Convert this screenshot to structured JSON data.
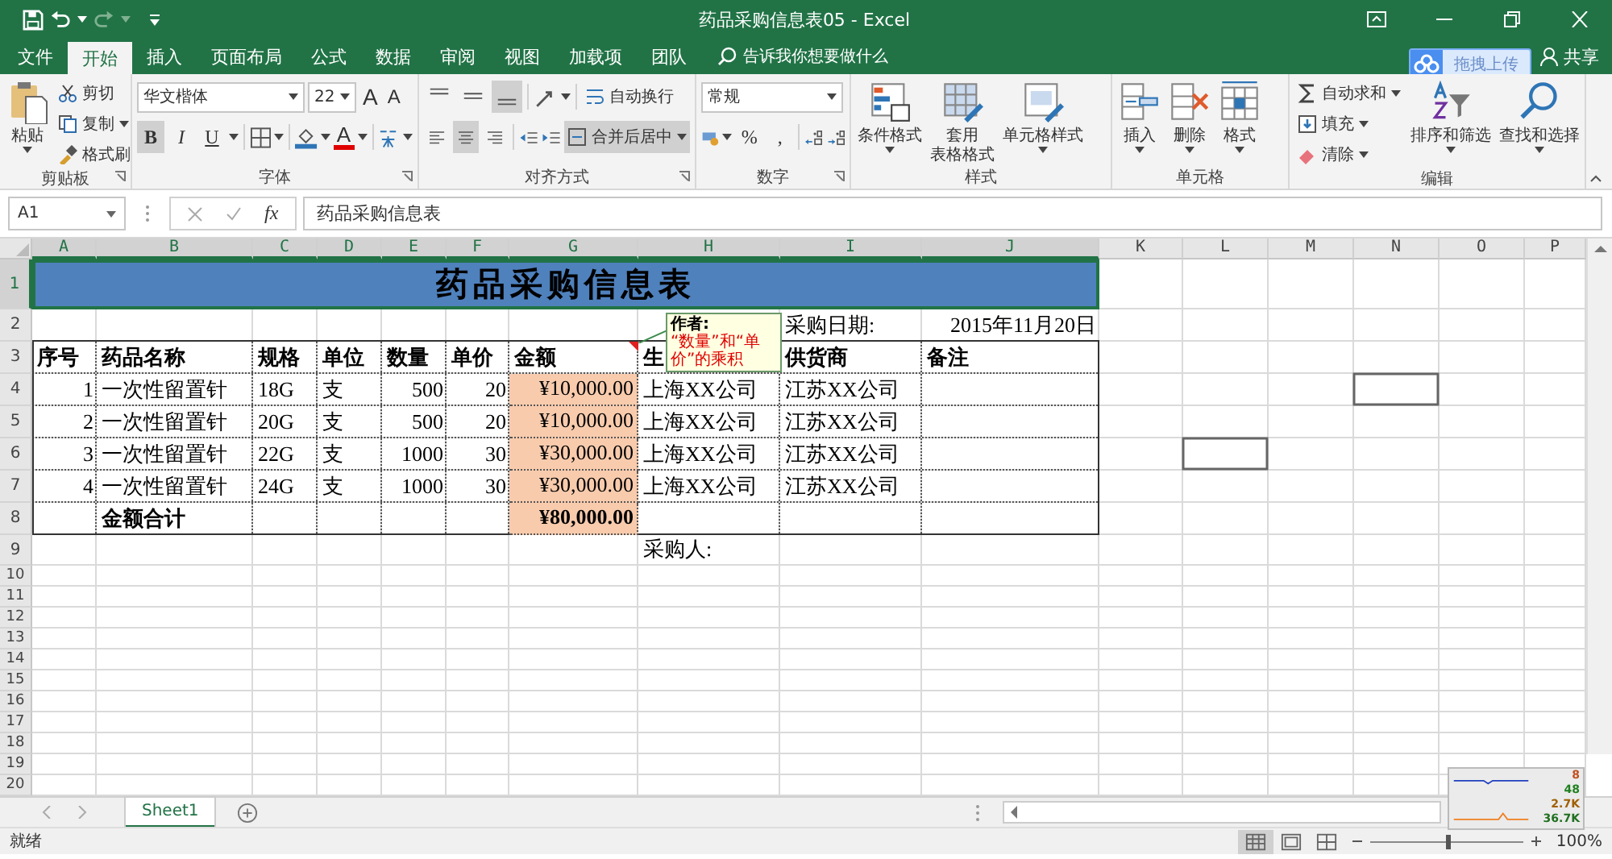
{
  "window": {
    "title": "药品采购信息表05  -  Excel"
  },
  "menu_tabs": [
    {
      "label": "文件",
      "selected": false
    },
    {
      "label": "开始",
      "selected": true
    },
    {
      "label": "插入",
      "selected": false
    },
    {
      "label": "页面布局",
      "selected": false
    },
    {
      "label": "公式",
      "selected": false
    },
    {
      "label": "数据",
      "selected": false
    },
    {
      "label": "审阅",
      "selected": false
    },
    {
      "label": "视图",
      "selected": false
    },
    {
      "label": "加载项",
      "selected": false
    },
    {
      "label": "团队",
      "selected": false
    }
  ],
  "tell_me": {
    "placeholder": "告诉我你想要做什么"
  },
  "upload_button": "拖拽上传",
  "share": "共享",
  "ribbon": {
    "clipboard": {
      "title": "剪贴板",
      "paste": "粘贴",
      "cut": "剪切",
      "copy": "复制",
      "format_painter": "格式刷"
    },
    "font": {
      "title": "字体",
      "font_name": "华文楷体",
      "font_size": "22",
      "grow": "A",
      "shrink": "A",
      "styles": [
        {
          "label": "B",
          "selected": true
        },
        {
          "label": "I",
          "selected": false
        },
        {
          "label": "U",
          "selected": false
        }
      ],
      "font_color": "A"
    },
    "alignment": {
      "title": "对齐方式",
      "vertical": [
        {
          "selected": false
        },
        {
          "selected": false
        },
        {
          "selected": true
        }
      ],
      "horizontal": [
        {
          "selected": false
        },
        {
          "selected": true
        },
        {
          "selected": false
        }
      ],
      "wrap": "自动换行",
      "merge": {
        "label": "合并后居中",
        "selected": true
      }
    },
    "number": {
      "title": "数字",
      "format": "常规",
      "percent": "%",
      "comma": ","
    },
    "styles": {
      "title": "样式",
      "conditional": "条件格式",
      "table_format": [
        "套用",
        "表格格式"
      ],
      "cell_styles": "单元格样式"
    },
    "cells": {
      "title": "单元格",
      "insert": "插入",
      "delete": "删除",
      "format": "格式"
    },
    "editing": {
      "title": "编辑",
      "autosum": "自动求和",
      "fill": "填充",
      "clear": "清除",
      "sort": "排序和筛选",
      "find": "查找和选择"
    }
  },
  "formula_bar": {
    "name_box": "A1",
    "fx": "fx",
    "value": "药品采购信息表"
  },
  "sheet": {
    "columns": [
      {
        "label": "A",
        "selected": true
      },
      {
        "label": "B",
        "selected": true
      },
      {
        "label": "C",
        "selected": true
      },
      {
        "label": "D",
        "selected": true
      },
      {
        "label": "E",
        "selected": true
      },
      {
        "label": "F",
        "selected": true
      },
      {
        "label": "G",
        "selected": true
      },
      {
        "label": "H",
        "selected": true
      },
      {
        "label": "I",
        "selected": true
      },
      {
        "label": "J",
        "selected": true
      },
      {
        "label": "K",
        "selected": false
      },
      {
        "label": "L",
        "selected": false
      },
      {
        "label": "M",
        "selected": false
      },
      {
        "label": "N",
        "selected": false
      },
      {
        "label": "O",
        "selected": false
      },
      {
        "label": "P",
        "selected": false
      }
    ],
    "title_row": {
      "number": "1",
      "selected": true,
      "text": "药品采购信息表"
    },
    "date_row": {
      "number": "2",
      "selected": false,
      "label": "采购日期:",
      "value": "2015年11月20日"
    },
    "header_row": {
      "number": "3",
      "selected": false,
      "headers": [
        "序号",
        "药品名称",
        "规格",
        "单位",
        "数量",
        "单价",
        "金额",
        "生",
        "供货商",
        "备注"
      ]
    },
    "rows": [
      {
        "number": "4",
        "selected": false,
        "cells": [
          "1",
          "一次性留置针",
          "18G",
          "支",
          "500",
          "20",
          "¥10,000.00",
          "上海XX公司",
          "江苏XX公司"
        ]
      },
      {
        "number": "5",
        "selected": false,
        "cells": [
          "2",
          "一次性留置针",
          "20G",
          "支",
          "500",
          "20",
          "¥10,000.00",
          "上海XX公司",
          "江苏XX公司"
        ]
      },
      {
        "number": "6",
        "selected": false,
        "cells": [
          "3",
          "一次性留置针",
          "22G",
          "支",
          "1000",
          "30",
          "¥30,000.00",
          "上海XX公司",
          "江苏XX公司"
        ]
      },
      {
        "number": "7",
        "selected": false,
        "cells": [
          "4",
          "一次性留置针",
          "24G",
          "支",
          "1000",
          "30",
          "¥30,000.00",
          "上海XX公司",
          "江苏XX公司"
        ]
      }
    ],
    "total_row": {
      "number": "8",
      "selected": false,
      "label": "金额合计",
      "amount": "¥80,000.00"
    },
    "buyer_row": {
      "number": "9",
      "selected": false,
      "label": "采购人:"
    },
    "empty_rows": [
      {
        "number": "10",
        "selected": false
      },
      {
        "number": "11",
        "selected": false
      },
      {
        "number": "12",
        "selected": false
      },
      {
        "number": "13",
        "selected": false
      },
      {
        "number": "14",
        "selected": false
      },
      {
        "number": "15",
        "selected": false
      },
      {
        "number": "16",
        "selected": false
      },
      {
        "number": "17",
        "selected": false
      },
      {
        "number": "18",
        "selected": false
      },
      {
        "number": "19",
        "selected": false
      },
      {
        "number": "20",
        "selected": false
      }
    ],
    "comment": {
      "author": "作者:",
      "text": "“数量”和“单价”的乘积"
    }
  },
  "sheet_tabs": [
    {
      "label": "Sheet1",
      "selected": true
    }
  ],
  "status_bar": {
    "status": "就绪",
    "zoom": "100%",
    "zoom_slider": {
      "level": 0.5
    },
    "views": [
      {
        "selected": true
      },
      {
        "selected": false
      },
      {
        "selected": false
      }
    ]
  },
  "network_widget": {
    "readings": [
      "8",
      "48",
      "2.7K",
      "36.7K"
    ]
  }
}
